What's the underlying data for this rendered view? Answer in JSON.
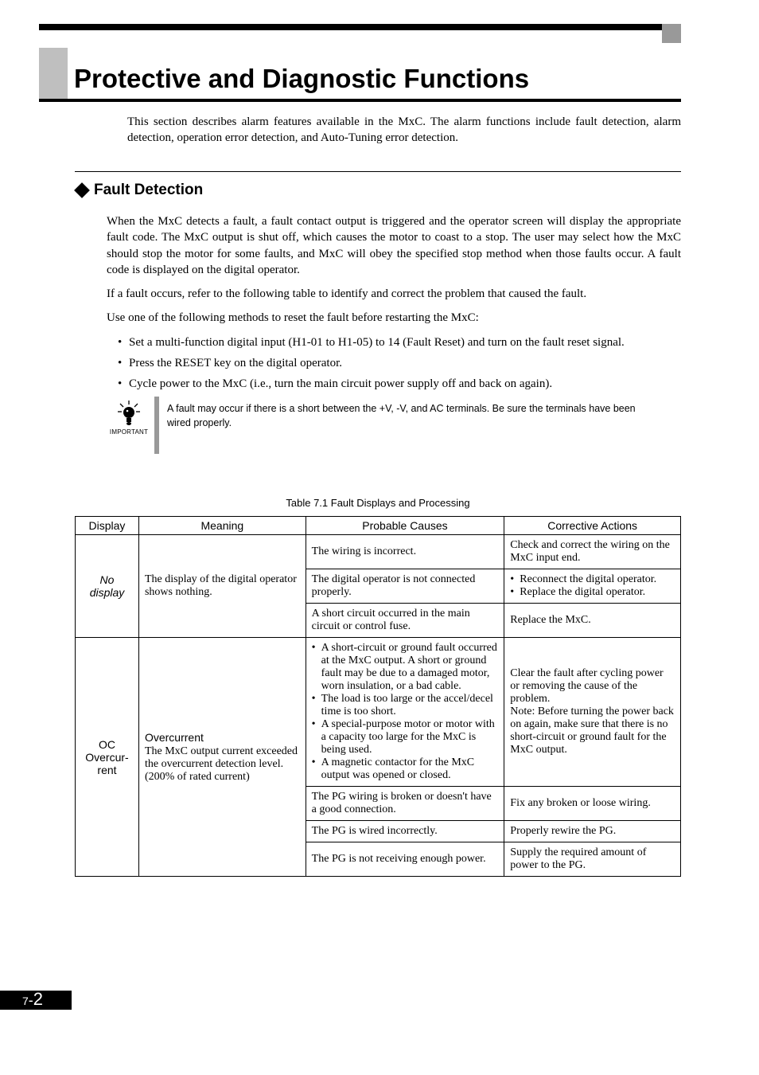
{
  "chapter_title": "Protective and Diagnostic Functions",
  "intro": "This section describes alarm features available in the MxC. The alarm functions include fault detection, alarm detection, operation error detection, and Auto-Tuning error detection.",
  "section": {
    "title": "Fault Detection",
    "p1": "When the MxC detects a fault, a fault contact output is triggered and the operator screen will display the appropriate fault code. The MxC output is shut off, which causes the motor to coast to a stop. The user may select how the MxC should stop the motor for some faults, and MxC will obey the specified stop method when those faults occur. A fault code is displayed on the digital operator.",
    "p2": "If a fault occurs, refer to the following table to identify and correct the problem that caused the fault.",
    "p3": "Use one of the following methods to reset the fault before restarting the MxC:",
    "bullets": [
      "Set a multi-function digital input (H1-01 to H1-05) to 14 (Fault Reset) and turn on the fault reset signal.",
      "Press the RESET key on the digital operator.",
      "Cycle power to the MxC (i.e., turn the main circuit power supply off and back on again)."
    ]
  },
  "important": {
    "label": "IMPORTANT",
    "icon_name": "idea-icon",
    "text": "A fault may occur if there is a short between the +V, -V, and AC terminals. Be sure the terminals have been wired properly."
  },
  "table": {
    "caption": "Table 7.1  Fault Displays and Processing",
    "headers": {
      "display": "Display",
      "meaning": "Meaning",
      "causes": "Probable Causes",
      "actions": "Corrective Actions"
    },
    "rows": [
      {
        "display_html": "No display",
        "display_italic": true,
        "meaning_html": "The display of the digital operator shows nothing.",
        "sub": [
          {
            "cause": "The wiring is incorrect.",
            "action": "Check and correct the wiring on the MxC input end."
          },
          {
            "cause": "The digital operator is not connected properly.",
            "action_list": [
              "Reconnect the digital operator.",
              "Replace the digital operator."
            ]
          },
          {
            "cause": "A short circuit occurred in the main circuit or control fuse.",
            "action": "Replace the MxC."
          }
        ]
      },
      {
        "display_lines": [
          "OC",
          "Overcur-",
          "rent"
        ],
        "meaning_title": "Overcurrent",
        "meaning_body": "The MxC output current exceeded the overcurrent detection level. (200% of rated current)",
        "sub": [
          {
            "cause_list": [
              "A short-circuit or ground fault occurred at the MxC output. A short or ground fault may be due to a damaged motor, worn insulation, or a bad cable.",
              "The load is too large or the accel/decel time is too short.",
              "A special-purpose motor or motor with a capacity too large for the MxC is being used.",
              "A magnetic contactor for the MxC output was opened or closed."
            ],
            "action": "Clear the fault after cycling power or removing the cause of the problem.\nNote: Before turning the power back on again, make sure that there is no short-circuit or ground fault for the MxC output."
          },
          {
            "cause": "The PG wiring is broken or doesn't have a good connection.",
            "action": "Fix any broken or loose wiring."
          },
          {
            "cause": "The PG is wired incorrectly.",
            "action": "Properly rewire the PG."
          },
          {
            "cause": "The PG is not receiving enough power.",
            "action": "Supply the required amount of power to the PG."
          }
        ]
      }
    ]
  },
  "footer": {
    "chapter": "7",
    "dash": "-",
    "page": "2"
  }
}
